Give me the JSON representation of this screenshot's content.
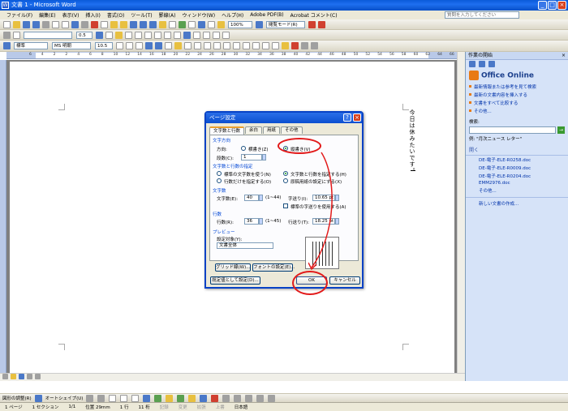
{
  "window": {
    "title": "文書 1 - Microsoft Word",
    "min": "_",
    "max": "□",
    "close": "×"
  },
  "menu": [
    "ファイル(F)",
    "編集(E)",
    "表示(V)",
    "挿入(I)",
    "書式(O)",
    "ツール(T)",
    "罫線(A)",
    "ウィンドウ(W)",
    "ヘルプ(H)",
    "Adobe PDF(B)",
    "Acrobat コメント(C)"
  ],
  "help_placeholder": "質問を入力してください",
  "toolbar": {
    "zoom": "100%",
    "read_mode": "閲覧モード(R)",
    "style": "標準",
    "font": "MS 明朝",
    "size": "10.5",
    "line_width": "0.5"
  },
  "ruler_numbers": [
    "6",
    "4",
    "2",
    "2",
    "4",
    "6",
    "8",
    "10",
    "12",
    "14",
    "16",
    "18",
    "20",
    "22",
    "24",
    "26",
    "28",
    "30",
    "32",
    "34",
    "36",
    "38",
    "40",
    "42",
    "44",
    "46",
    "48",
    "50",
    "52",
    "54",
    "56",
    "58",
    "60",
    "62",
    "64",
    "66",
    "68"
  ],
  "document": {
    "vertical_text": "今日は休みたいです。"
  },
  "taskpane": {
    "title": "作業の開始",
    "logo": "Office Online",
    "links": [
      "最新情報または参考を見て検索",
      "最新の文書内容を挿入する",
      "文書をすべて比較する",
      "その他..."
    ],
    "search_label": "検索:",
    "search_example": "例: \"月次ニュース レター\"",
    "open_header": "開く",
    "files": [
      "DE-電子-ELE-R0258.doc",
      "DE-電子-ELE-R0009.doc",
      "DE-電子-ELE-R0204.doc",
      "EMM2976.doc"
    ],
    "more": "その他...",
    "new_doc": "新しい文書の作成..."
  },
  "dialog": {
    "title": "ページ設定",
    "help": "?",
    "close": "×",
    "tabs": [
      "文字数と行数",
      "余白",
      "用紙",
      "その他"
    ],
    "direction_group": "文字方向",
    "direction_label": "方向:",
    "horizontal": "横書き(Z)",
    "vertical": "縦書き(V)",
    "columns_label": "段数(C):",
    "columns_value": "1",
    "grid_group": "文字数と行数の指定",
    "grid_opt1": "標準の文字数を使う(N)",
    "grid_opt2": "文字数と行数を指定する(H)",
    "grid_opt3": "行数だけを指定する(O)",
    "grid_opt4": "原稿用紙の設定にする(X)",
    "chars_group": "文字数",
    "chars_label": "文字数(E):",
    "chars_value": "40",
    "chars_range": "(1~44)",
    "char_pitch_label": "字送り(I):",
    "char_pitch_value": "10.65 pt",
    "default_pitch": "標準の字送りを使用する(A)",
    "lines_group": "行数",
    "lines_label": "行数(R):",
    "lines_value": "36",
    "lines_range": "(1~45)",
    "line_pitch_label": "行送り(T):",
    "line_pitch_value": "18.25 pt",
    "preview_group": "プレビュー",
    "apply_label": "設定対象(Y):",
    "apply_value": "文書全体",
    "grid_lines_btn": "グリッド線(W)...",
    "font_settings_btn": "フォントの設定(E)...",
    "default_btn": "既定値として設定(D)...",
    "ok": "OK",
    "cancel": "キャンセル"
  },
  "drawbar": {
    "draw": "図形の調整(R)",
    "autoshapes": "オートシェイプ(U)"
  },
  "status": [
    "1 ページ",
    "1 セクション",
    "1/1",
    "位置 29mm",
    "1 行",
    "11 桁",
    "記録",
    "変更",
    "拡張",
    "上書",
    "日本語"
  ]
}
